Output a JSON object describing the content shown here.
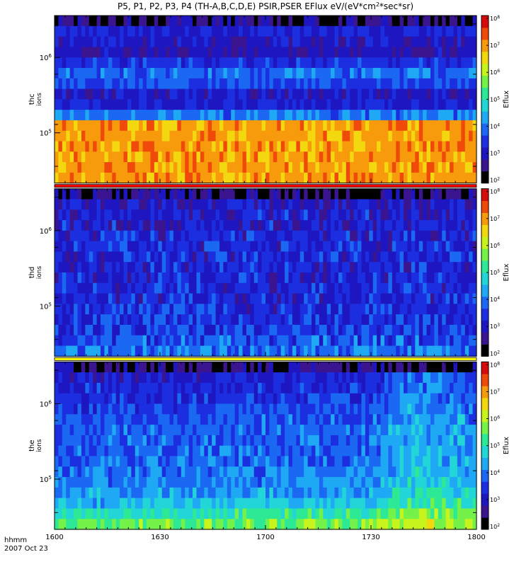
{
  "title": "P5, P1, P2, P3, P4 (TH-A,B,C,D,E) PSIR,PSER EFlux eV/(eV*cm",
  "title_sup": "2",
  "title_tail": "*sec*sr)",
  "colorbar_label": "Eflux",
  "time_axis": {
    "label_line1": "hhmm",
    "label_line2": "2007 Oct 23",
    "ticks": [
      "1600",
      "1630",
      "1700",
      "1730",
      "1800"
    ]
  },
  "colors": {
    "flag_yellow": "#ffff00",
    "flag_red": "#ff0000",
    "colormap": [
      "#000000",
      "#3b1590",
      "#1e16c0",
      "#1c2fe0",
      "#1b68f2",
      "#1fa8f4",
      "#22d6d8",
      "#2de894",
      "#74f24a",
      "#c6f41c",
      "#f3d810",
      "#f79a0c",
      "#ef4a0a",
      "#d80b0b"
    ]
  },
  "chart_data": [
    {
      "type": "heatmap",
      "name_line1": "thc",
      "name_line2": "ions",
      "ylabels": [
        {
          "base": "10",
          "exp": "6"
        },
        {
          "base": "10",
          "exp": "5"
        }
      ],
      "cbar_ticks": [
        {
          "base": "10",
          "exp": "8"
        },
        {
          "base": "10",
          "exp": "7"
        },
        {
          "base": "10",
          "exp": "6"
        },
        {
          "base": "10",
          "exp": "5"
        },
        {
          "base": "10",
          "exp": "4"
        },
        {
          "base": "10",
          "exp": "3"
        },
        {
          "base": "10",
          "exp": "2"
        }
      ],
      "profile": [
        0.05,
        0.22,
        0.18,
        0.16,
        0.24,
        0.32,
        0.28,
        0.18,
        0.22,
        0.34,
        0.82,
        0.82,
        0.82,
        0.82,
        0.82,
        0.82
      ],
      "noise": 0.12,
      "trend": []
    },
    {
      "type": "heatmap",
      "name_line1": "thd",
      "name_line2": "ions",
      "ylabels": [
        {
          "base": "10",
          "exp": "6"
        },
        {
          "base": "10",
          "exp": "5"
        }
      ],
      "cbar_ticks": [
        {
          "base": "10",
          "exp": "8"
        },
        {
          "base": "10",
          "exp": "7"
        },
        {
          "base": "10",
          "exp": "6"
        },
        {
          "base": "10",
          "exp": "5"
        },
        {
          "base": "10",
          "exp": "4"
        },
        {
          "base": "10",
          "exp": "3"
        },
        {
          "base": "10",
          "exp": "2"
        }
      ],
      "profile": [
        0.05,
        0.18,
        0.2,
        0.2,
        0.21,
        0.22,
        0.22,
        0.22,
        0.22,
        0.22,
        0.22,
        0.23,
        0.24,
        0.26,
        0.28,
        0.34
      ],
      "noise": 0.18,
      "trend": []
    },
    {
      "type": "heatmap",
      "name_line1": "the",
      "name_line2": "ions",
      "ylabels": [
        {
          "base": "10",
          "exp": "6"
        },
        {
          "base": "10",
          "exp": "5"
        }
      ],
      "cbar_ticks": [
        {
          "base": "10",
          "exp": "8"
        },
        {
          "base": "10",
          "exp": "7"
        },
        {
          "base": "10",
          "exp": "6"
        },
        {
          "base": "10",
          "exp": "5"
        },
        {
          "base": "10",
          "exp": "4"
        },
        {
          "base": "10",
          "exp": "3"
        },
        {
          "base": "10",
          "exp": "2"
        }
      ],
      "profile": [
        0.05,
        0.2,
        0.22,
        0.24,
        0.26,
        0.28,
        0.3,
        0.3,
        0.3,
        0.31,
        0.32,
        0.34,
        0.37,
        0.42,
        0.5,
        0.58
      ],
      "noise": 0.14,
      "trend": [
        [
          0,
          0
        ],
        [
          0.75,
          0.02
        ],
        [
          0.85,
          0.12
        ],
        [
          0.95,
          0.1
        ],
        [
          1,
          0.06
        ]
      ]
    }
  ]
}
